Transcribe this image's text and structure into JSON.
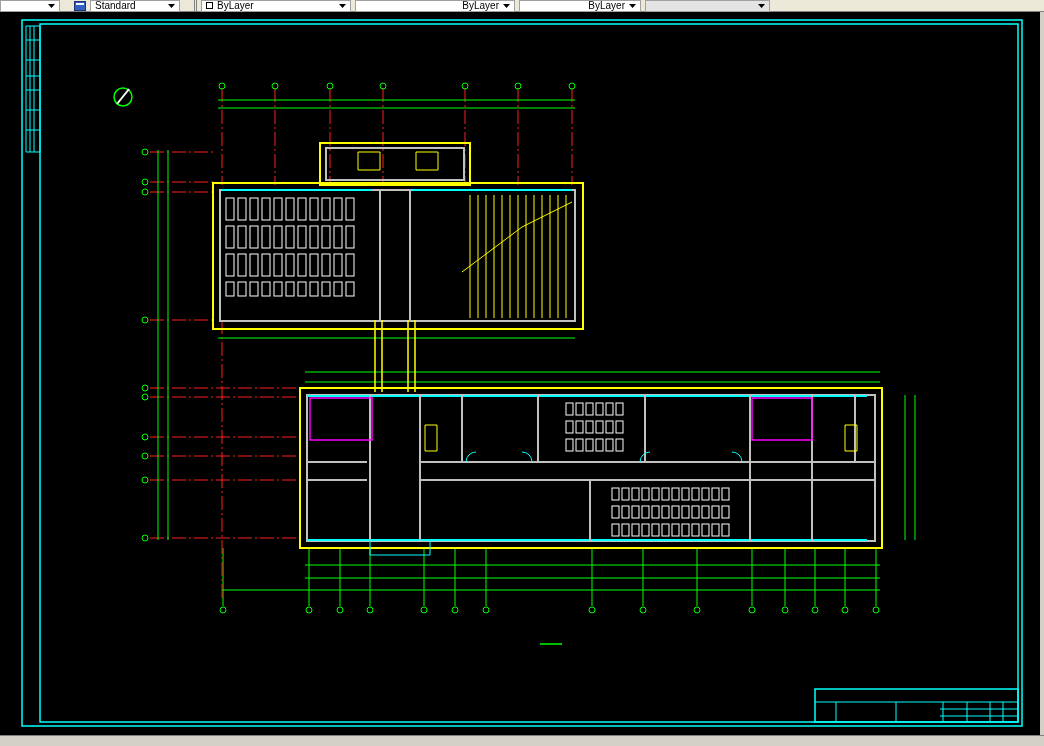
{
  "toolbar": {
    "text_style": "Standard",
    "property_combos": [
      {
        "value": "ByLayer"
      },
      {
        "value": "ByLayer"
      },
      {
        "value": "ByLayer"
      }
    ],
    "plot_style": {
      "disabled": true
    }
  }
}
